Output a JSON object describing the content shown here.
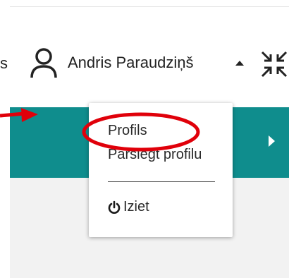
{
  "header": {
    "partial_text": "s",
    "user_name": "Andris Paraudziņš"
  },
  "menu": {
    "items": [
      {
        "label": "Profils"
      },
      {
        "label": "Pārslēgt profilu"
      },
      {
        "label": "Iziet"
      }
    ]
  },
  "colors": {
    "teal": "#0f8d8d",
    "annotation_red": "#e0000a"
  },
  "icons": [
    "user-icon",
    "caret-up-icon",
    "compress-icon",
    "play-icon",
    "power-icon",
    "arrow-annotation"
  ]
}
